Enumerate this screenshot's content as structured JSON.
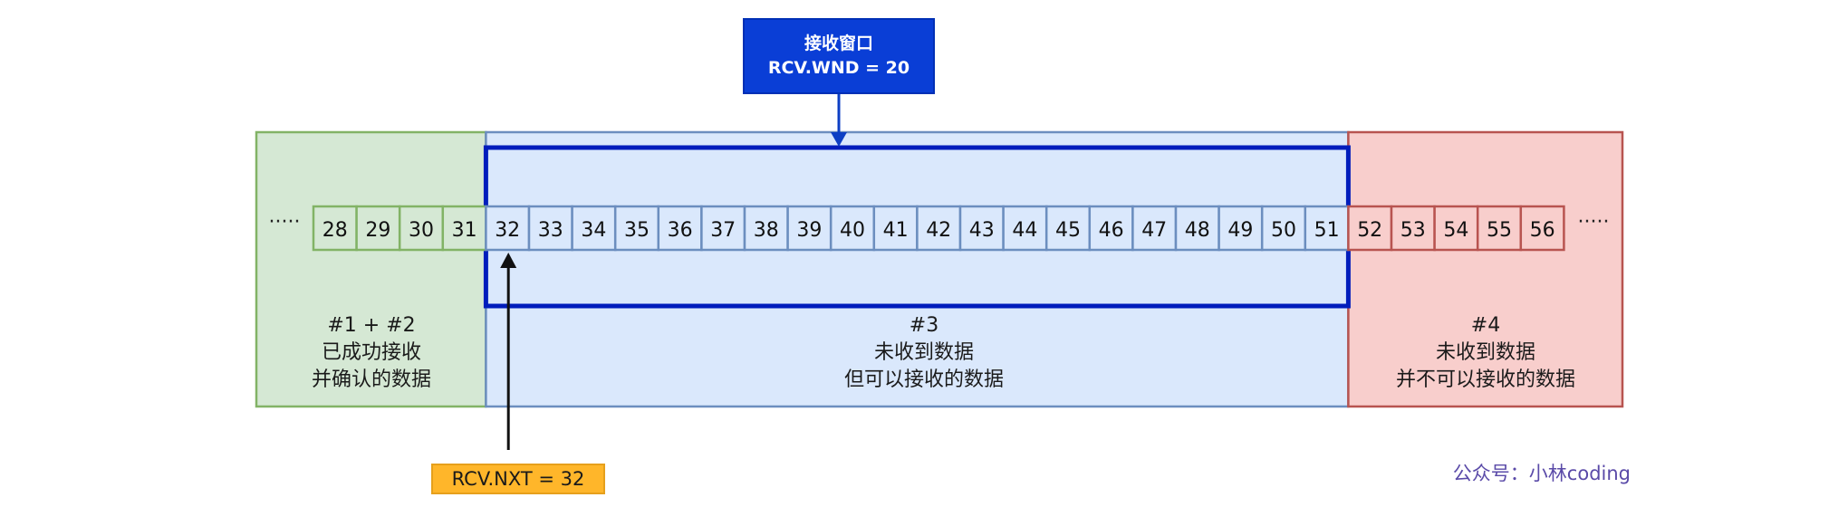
{
  "receive_window": {
    "title": "接收窗口",
    "param": "RCV.WND = 20"
  },
  "rcv_nxt": {
    "label": "RCV.NXT = 32"
  },
  "ellipsis_left": "·····",
  "ellipsis_right": "·····",
  "sequence": {
    "first": 28,
    "last": 56,
    "rcv_nxt": 32,
    "window_end": 51
  },
  "regions": [
    {
      "key": "acked",
      "fill": "#d5e8d4",
      "stroke": "#82b366",
      "lines": [
        "#1 + #2",
        "已成功接收",
        "并确认的数据"
      ]
    },
    {
      "key": "window",
      "fill": "#dae8fc",
      "stroke": "#6c8ebf",
      "lines": [
        "#3",
        "未收到数据",
        "但可以接收的数据"
      ]
    },
    {
      "key": "outside",
      "fill": "#f8cecc",
      "stroke": "#b85450",
      "lines": [
        "#4",
        "未收到数据",
        "并不可以接收的数据"
      ]
    }
  ],
  "colors": {
    "window_frame": "#001dbc",
    "window_box": "#0a3ed6",
    "nxt_box": "#ffb62a",
    "arrow_blue": "#0d3fc4",
    "arrow_black": "#111111"
  },
  "watermark": "公众号：小林coding"
}
